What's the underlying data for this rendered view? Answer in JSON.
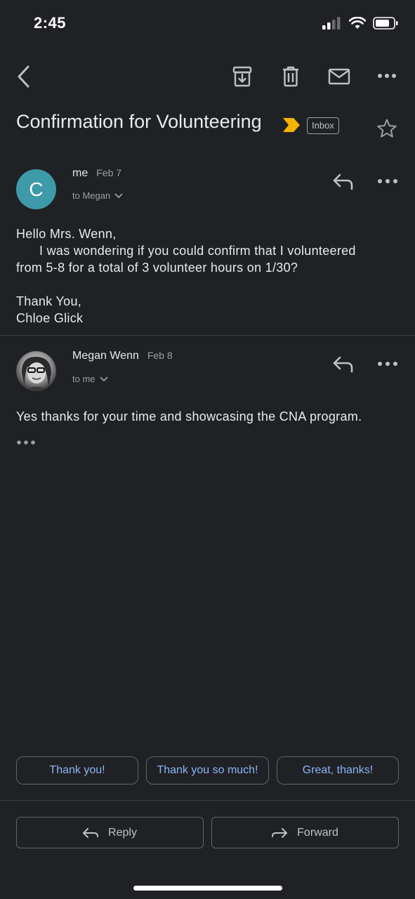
{
  "status_bar": {
    "time": "2:45"
  },
  "email": {
    "subject": "Confirmation for Volunteering",
    "label": "Inbox",
    "messages": [
      {
        "avatar_letter": "C",
        "sender": "me",
        "date": "Feb 7",
        "to": "to Megan",
        "body": [
          "Hello Mrs. Wenn,",
          "I was wondering if you could confirm that I volunteered",
          "from 5-8 for a total of 3 volunteer hours on 1/30?",
          "Thank You,",
          "Chloe Glick"
        ]
      },
      {
        "sender": "Megan Wenn",
        "date": "Feb 8",
        "to": "to me",
        "body": [
          "Yes thanks for your time and showcasing the CNA program."
        ]
      }
    ]
  },
  "smart_replies": [
    "Thank you!",
    "Thank you so much!",
    "Great, thanks!"
  ],
  "actions": {
    "reply": "Reply",
    "forward": "Forward"
  },
  "colors": {
    "background": "#202124",
    "avatar": "#3e9aa9",
    "link": "#8ab4f8",
    "important": "#f4b400"
  },
  "icons": [
    "back-icon",
    "archive-icon",
    "delete-icon",
    "mark-unread-icon",
    "more-icon",
    "important-icon",
    "star-icon",
    "reply-icon",
    "forward-icon"
  ]
}
